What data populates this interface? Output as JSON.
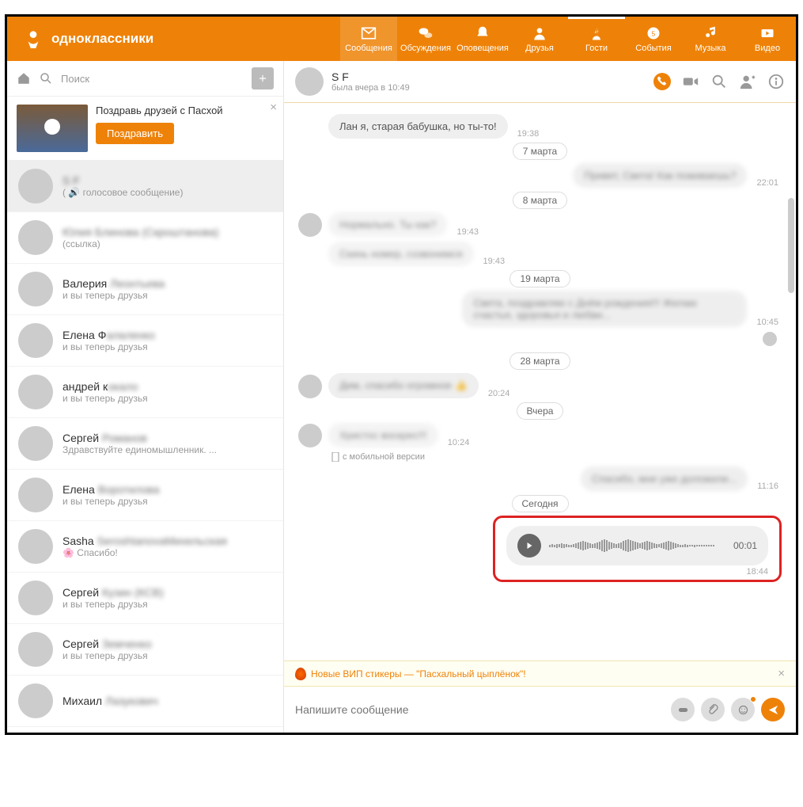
{
  "brand": "одноклассники",
  "nav": {
    "messages": "Сообщения",
    "discussions": "Обсуждения",
    "notifications": "Оповещения",
    "friends": "Друзья",
    "guests": "Гости",
    "events": "События",
    "music": "Музыка",
    "video": "Видео"
  },
  "search": {
    "placeholder": "Поиск"
  },
  "promo": {
    "title": "Поздравь друзей с Пасхой",
    "button": "Поздравить"
  },
  "conversations": [
    {
      "name": "S F",
      "sub": "( 🔊 голосовое сообщение)",
      "selected": true
    },
    {
      "name": "Юлия Блинова (Скроштанова)",
      "sub": "(ссылка)"
    },
    {
      "name": "Валерия Леонтьева",
      "sub": "и вы теперь друзья"
    },
    {
      "name": "Елена Фалаленко",
      "sub": "и вы теперь друзья"
    },
    {
      "name": "андрей кокало",
      "sub": "и вы теперь друзья"
    },
    {
      "name": "Сергей Романов",
      "sub": "Здравствуйте единомышленник. ..."
    },
    {
      "name": "Елена Воротилова",
      "sub": "и вы теперь друзья"
    },
    {
      "name": "Sasha SeroshtanоvaМихельская",
      "sub": "🌸 Спасибо!"
    },
    {
      "name": "Сергей Кузин (КСВ)",
      "sub": "и вы теперь друзья"
    },
    {
      "name": "Сергей Земченко",
      "sub": "и вы теперь друзья"
    },
    {
      "name": "Михаил Лазукович",
      "sub": ""
    }
  ],
  "chat": {
    "title": "S F",
    "status": "была вчера в 10:49"
  },
  "messages": {
    "m0": {
      "text": "Лан я, старая бабушка, но ты-то!",
      "time": "19:38"
    },
    "d1": "7 марта",
    "m1": {
      "text": "Привет, Света! Как поживаешь?",
      "time": "22:01"
    },
    "d2": "8 марта",
    "m2": {
      "text": "Нормально. Ты как?",
      "time": "19:43"
    },
    "m3": {
      "text": "Скинь номер, созвонимся",
      "time": "19:43"
    },
    "d3": "19 марта",
    "m4": {
      "text": "Света, поздравляю с Днём рождения!!! Желаю счастья, здоровья и любви...",
      "time": "10:45"
    },
    "d4": "28 марта",
    "m5": {
      "text": "Дим, спасибо огромное 👍",
      "time": "20:24"
    },
    "d5": "Вчера",
    "m6": {
      "text": "Христос воскрес!!!",
      "time": "10:24"
    },
    "mobile": "с мобильной версии",
    "m7": {
      "text": "Спасибо, мне уже доложили...",
      "time": "11:16"
    },
    "d6": "Сегодня",
    "voice": {
      "duration": "00:01",
      "time": "18:44"
    }
  },
  "banner": "Новые ВИП стикеры — \"Пасхальный цыплёнок\"!",
  "compose": {
    "placeholder": "Напишите сообщение"
  }
}
